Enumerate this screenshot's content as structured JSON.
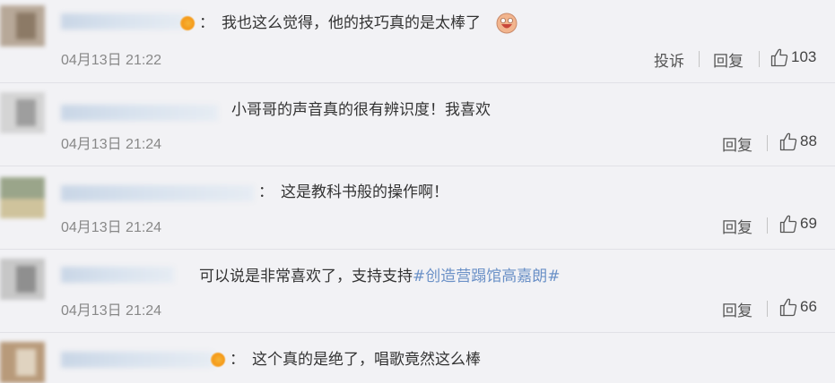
{
  "comments": [
    {
      "text": "我也这么觉得，他的技巧真的是太棒了",
      "time": "04月13日 21:22",
      "report_label": "投诉",
      "reply_label": "回复",
      "likes": "103",
      "avatar_colors": [
        "#b7a898",
        "#8c7a66"
      ]
    },
    {
      "text": "小哥哥的声音真的很有辨识度！我喜欢",
      "time": "04月13日 21:24",
      "reply_label": "回复",
      "likes": "88",
      "avatar_colors": [
        "#d4d4d4",
        "#9e9e9e"
      ]
    },
    {
      "text": "这是教科书般的操作啊！",
      "time": "04月13日 21:24",
      "reply_label": "回复",
      "likes": "69",
      "avatar_colors": [
        "#9aa58a",
        "#cfc39c"
      ]
    },
    {
      "text_prefix": "可以说是非常喜欢了，支持支持",
      "topic": "#创造营蹋馆高嘉朗#",
      "time": "04月13日 21:24",
      "reply_label": "回复",
      "likes": "66",
      "avatar_colors": [
        "#c7c7c7",
        "#8f8f8f"
      ]
    },
    {
      "text": "这个真的是绝了，唱歌竟然这么棒",
      "avatar_colors": [
        "#b89a7a",
        "#e0d3c0"
      ]
    }
  ],
  "icons": {
    "like": "thumbs-up-icon",
    "emoji": "laughing-face-icon",
    "badge": "vip-badge-icon"
  },
  "colors": {
    "background": "#f2f2f5",
    "text": "#333333",
    "meta": "#888888",
    "topic": "#6b91c7"
  }
}
